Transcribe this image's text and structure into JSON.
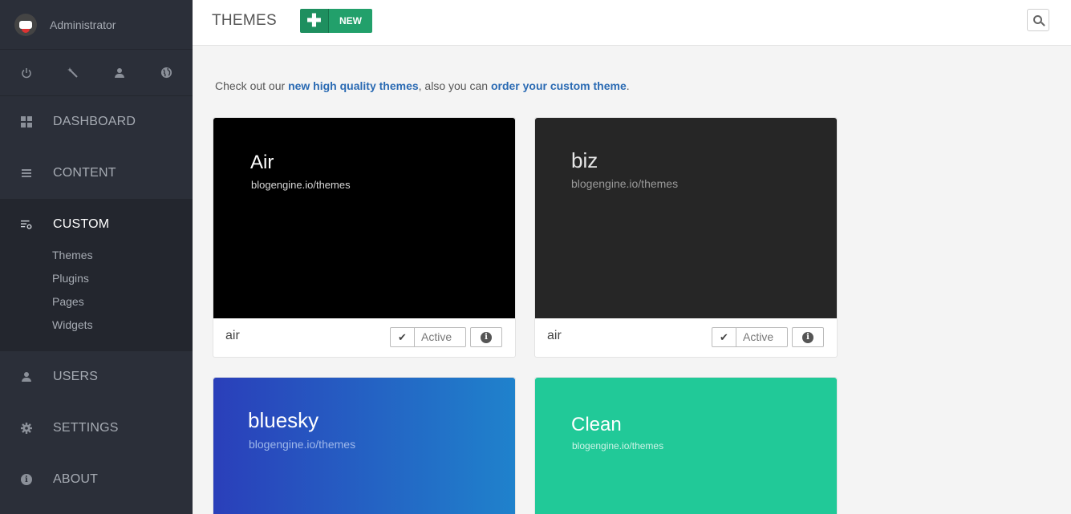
{
  "sidebar": {
    "user_name": "Administrator",
    "quick_icons": [
      "power-icon",
      "magic-wand-icon",
      "user-icon",
      "globe-icon"
    ],
    "nav": {
      "dashboard": "DASHBOARD",
      "content": "CONTENT",
      "custom": "CUSTOM",
      "users": "USERS",
      "settings": "SETTINGS",
      "about": "ABOUT"
    },
    "custom_sub": [
      "Themes",
      "Plugins",
      "Pages",
      "Widgets"
    ]
  },
  "header": {
    "title": "THEMES",
    "new_plus": "✚",
    "new_label": "NEW"
  },
  "intro": {
    "prefix": "Check out our ",
    "link1": "new high quality themes",
    "middle": ", also you can ",
    "link2": "order your custom theme",
    "suffix": "."
  },
  "themes": [
    {
      "preview_title": "Air",
      "preview_url": "blogengine.io/themes",
      "name": "air",
      "status": "Active",
      "bg": "#000000"
    },
    {
      "preview_title": "biz",
      "preview_url": "blogengine.io/themes",
      "name": "air",
      "status": "Active",
      "bg": "#262626"
    },
    {
      "preview_title": "bluesky",
      "preview_url": "blogengine.io/themes",
      "bg": "#2a3fba"
    },
    {
      "preview_title": "Clean",
      "preview_url": "blogengine.io/themes",
      "bg": "#21c998"
    }
  ],
  "colors": {
    "sidebar_bg": "#2b2f39",
    "accent_green": "#22a06b",
    "link_blue": "#2a6ab3"
  }
}
